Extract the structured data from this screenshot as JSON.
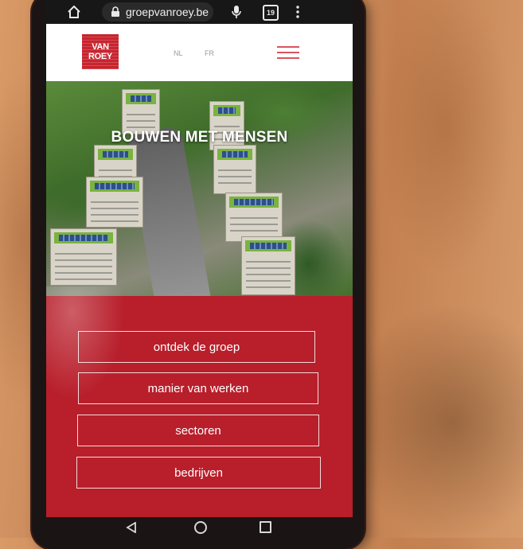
{
  "browser": {
    "url": "groepvanroey.be",
    "tab_count": "19"
  },
  "site": {
    "logo_line1": "VAN",
    "logo_line2": "ROEY",
    "lang_nl": "NL",
    "lang_fr": "FR"
  },
  "hero": {
    "title": "BOUWEN MET MENSEN"
  },
  "menu": {
    "items": [
      "ontdek de groep",
      "manier van werken",
      "sectoren",
      "bedrijven"
    ]
  },
  "colors": {
    "brand_red": "#b81f2b",
    "accent_pink": "#d9545d"
  },
  "icons": [
    "home-icon",
    "lock-icon",
    "mic-icon",
    "tabs-icon",
    "overflow-menu-icon",
    "hamburger-menu-icon",
    "back-icon",
    "home-circle-icon",
    "recent-apps-icon"
  ]
}
